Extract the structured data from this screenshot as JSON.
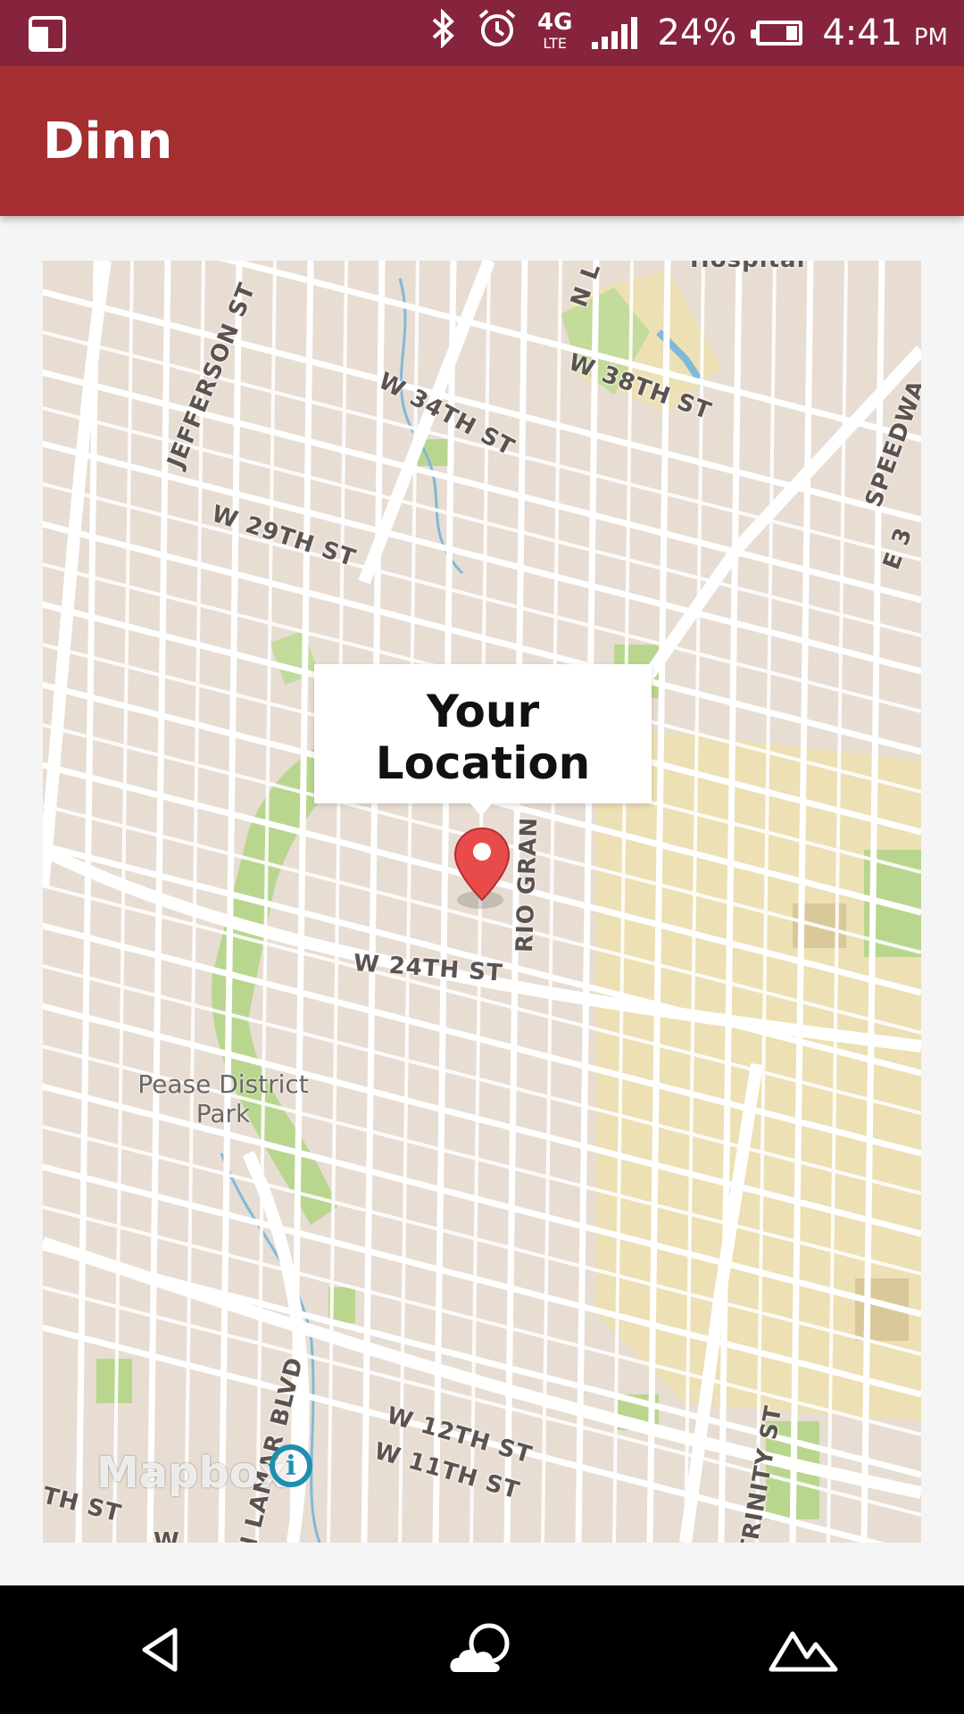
{
  "status_bar": {
    "network": "4G",
    "network_sub": "LTE",
    "battery": "24%",
    "time": "4:41",
    "ampm": "PM",
    "icons": [
      "screen-icon",
      "bluetooth-icon",
      "alarm-icon",
      "signal-icon",
      "battery-icon"
    ]
  },
  "app_bar": {
    "title": "Dinn"
  },
  "map": {
    "popup_title": "Your Location",
    "attribution": "Mapbox",
    "streets": {
      "jefferson": "JEFFERSON ST",
      "w34": "W 34TH ST",
      "w38": "W 38TH ST",
      "speedway": "SPEEDWA",
      "w29": "W 29TH ST",
      "e3": "E 3",
      "hospital": "Hospital",
      "n_l": "N L",
      "rio_grande": "RIO GRAN",
      "w24": "W 24TH ST",
      "lamar": "N LAMAR BLVD",
      "w12": "W 12TH ST",
      "w11": "W 11TH ST",
      "trinity": "TRINITY ST",
      "th_st": "TH ST",
      "w": "W"
    },
    "park": "Pease District Park",
    "colors": {
      "land": "#e7ddd3",
      "road": "#ffffff",
      "park": "#b9d68e",
      "campus": "#ece0b4",
      "water": "#7fb9d8"
    }
  },
  "nav": {
    "items": [
      "back-icon",
      "cloud-icon",
      "mountain-icon"
    ]
  }
}
